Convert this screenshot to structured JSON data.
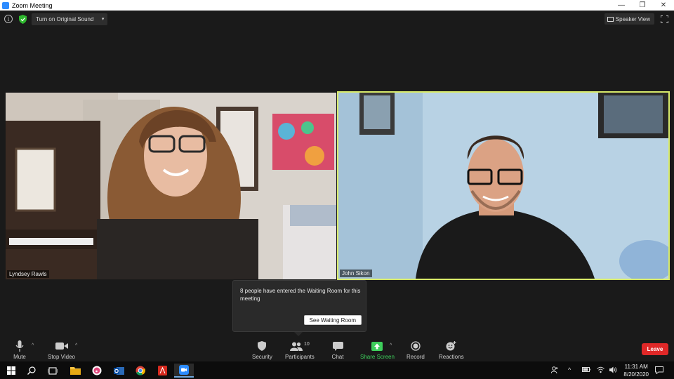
{
  "window": {
    "title": "Zoom Meeting",
    "controls": [
      "—",
      "❐",
      "✕"
    ]
  },
  "topbar": {
    "original_sound_label": "Turn on Original Sound",
    "speaker_view_label": "Speaker View"
  },
  "participants_tiles": [
    {
      "name": "Lyndsey Rawls"
    },
    {
      "name": "John Sikon"
    }
  ],
  "waiting_room": {
    "message": "8 people have entered the Waiting Room for this meeting",
    "button_label": "See Waiting Room"
  },
  "toolbar": {
    "mute_label": "Mute",
    "stop_video_label": "Stop Video",
    "security_label": "Security",
    "participants_label": "Participants",
    "participants_count": "10",
    "chat_label": "Chat",
    "share_screen_label": "Share Screen",
    "record_label": "Record",
    "reactions_label": "Reactions",
    "leave_label": "Leave"
  },
  "colors": {
    "active_speaker_border": "#d8ea6a",
    "share_green": "#3ecf5c",
    "leave_red": "#e02828",
    "zoom_blue": "#2d8cff"
  },
  "taskbar": {
    "time": "11:31 AM",
    "date": "8/20/2020"
  }
}
